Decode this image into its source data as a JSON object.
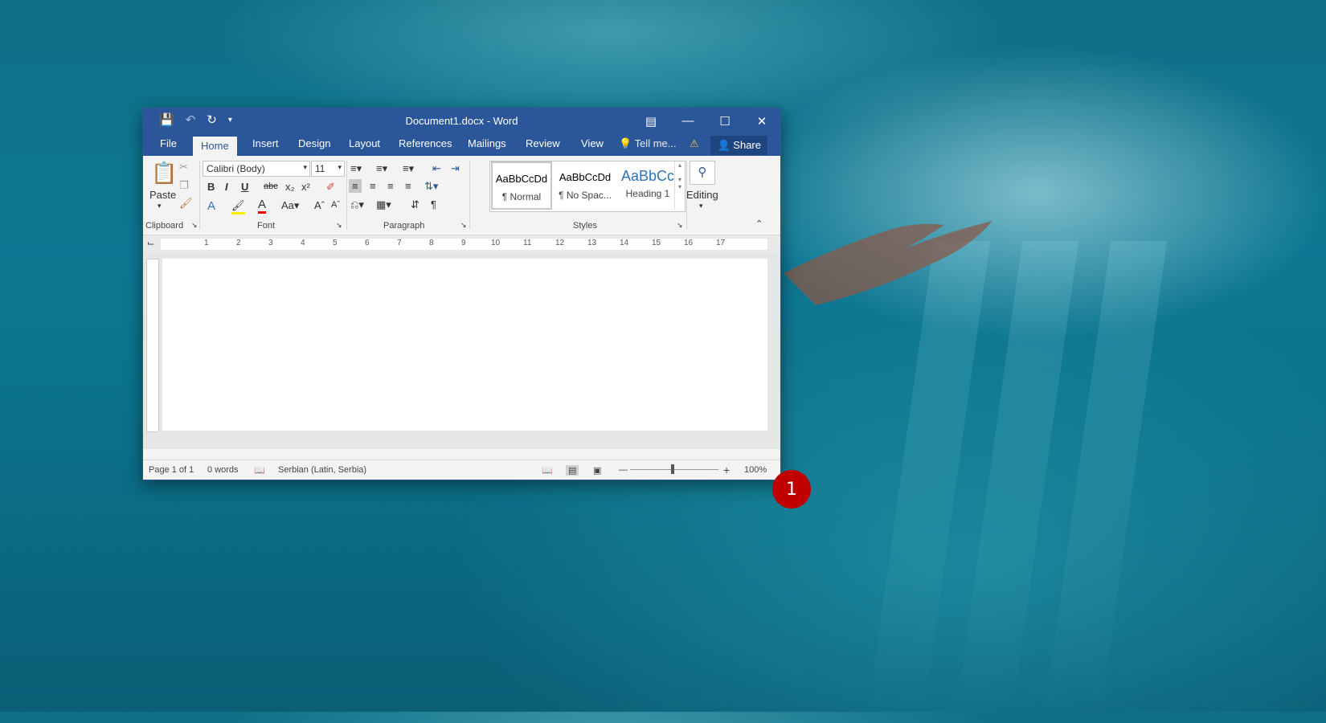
{
  "window": {
    "title": "Document1.docx - Word",
    "accent": "#2b579a"
  },
  "qat": {
    "save_icon": "save-icon",
    "undo_icon": "undo-icon",
    "redo_icon": "redo-icon"
  },
  "tabs": [
    "File",
    "Home",
    "Insert",
    "Design",
    "Layout",
    "References",
    "Mailings",
    "Review",
    "View"
  ],
  "tell_me": "Tell me...",
  "share": "Share",
  "ribbon": {
    "clipboard": {
      "paste": "Paste",
      "label": "Clipboard"
    },
    "font": {
      "name": "Calibri (Body)",
      "size": "11",
      "label": "Font"
    },
    "paragraph": {
      "label": "Paragraph"
    },
    "styles": {
      "label": "Styles",
      "items": [
        {
          "sample": "AaBbCcDd",
          "name": "¶ Normal"
        },
        {
          "sample": "AaBbCcDd",
          "name": "¶ No Spac..."
        },
        {
          "sample": "AaBbCc",
          "name": "Heading 1"
        }
      ]
    },
    "editing": {
      "label": "Editing"
    }
  },
  "ruler": [
    "1",
    "2",
    "3",
    "4",
    "5",
    "6",
    "7",
    "8",
    "9",
    "10",
    "11",
    "12",
    "13",
    "14",
    "15",
    "16",
    "17"
  ],
  "status": {
    "page": "Page 1 of 1",
    "words": "0 words",
    "language": "Serbian (Latin, Serbia)",
    "zoom": "100%"
  },
  "callout": "1"
}
